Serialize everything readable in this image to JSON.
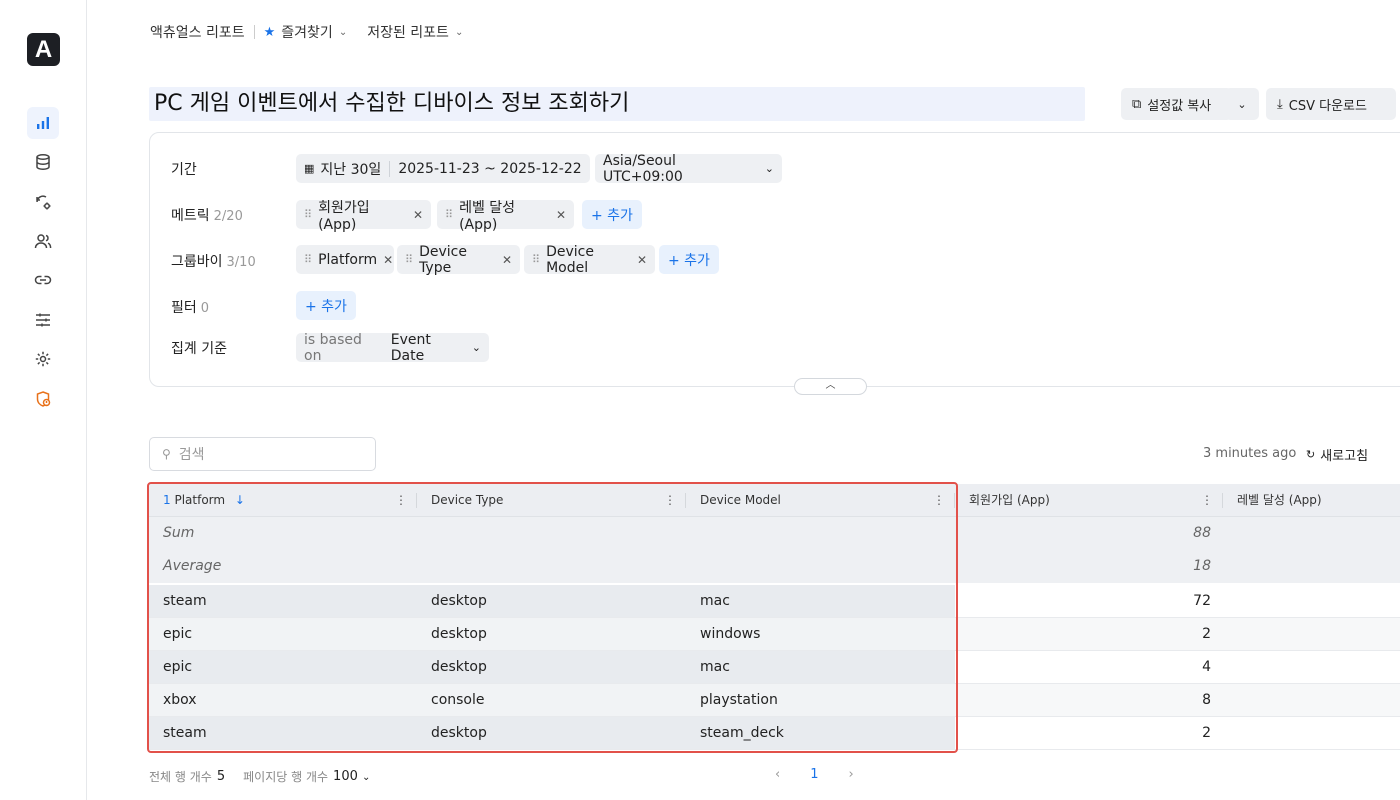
{
  "app": {
    "logo_letter": "A"
  },
  "sidebar": {
    "items": [
      {
        "name": "chart-icon"
      },
      {
        "name": "database-icon"
      },
      {
        "name": "sync-settings-icon"
      },
      {
        "name": "users-icon"
      },
      {
        "name": "link-icon"
      },
      {
        "name": "sliders-icon"
      },
      {
        "name": "gear-icon"
      },
      {
        "name": "security-alert-icon"
      }
    ],
    "accent": "#1a73e8",
    "alert_color": "#e8711a"
  },
  "breadcrumb": {
    "root": "액츄얼스 리포트",
    "favorites": "즐겨찾기",
    "saved": "저장된 리포트"
  },
  "report": {
    "title": "PC 게임 이벤트에서 수집한 디바이스 정보 조회하기",
    "copy_settings": "설정값 복사",
    "csv_download": "CSV 다운로드"
  },
  "filters": {
    "period_label": "기간",
    "period_preset": "지난 30일",
    "period_range": "2025-11-23 ~ 2025-12-22",
    "timezone": "Asia/Seoul UTC+09:00",
    "metrics_label": "메트릭",
    "metrics_count": "2/20",
    "metrics": [
      "회원가입 (App)",
      "레벨 달성 (App)"
    ],
    "groupby_label": "그룹바이",
    "groupby_count": "3/10",
    "groupby": [
      "Platform",
      "Device Type",
      "Device Model"
    ],
    "filter_label": "필터",
    "filter_count": "0",
    "add_label": "+ 추가",
    "agg_label": "집계 기준",
    "agg_prefix": "is based on",
    "agg_value": "Event Date"
  },
  "toolbar": {
    "search_placeholder": "검색",
    "updated": "3 minutes ago",
    "refresh": "새로고침"
  },
  "table": {
    "sort_index": "1",
    "columns": [
      "Platform",
      "Device Type",
      "Device Model",
      "회원가입 (App)",
      "레벨 달성 (App)"
    ],
    "sum_label": "Sum",
    "avg_label": "Average",
    "sum_value": "88",
    "avg_value": "18",
    "rows": [
      [
        "steam",
        "desktop",
        "mac",
        "72"
      ],
      [
        "epic",
        "desktop",
        "windows",
        "2"
      ],
      [
        "epic",
        "desktop",
        "mac",
        "4"
      ],
      [
        "xbox",
        "console",
        "playstation",
        "8"
      ],
      [
        "steam",
        "desktop",
        "steam_deck",
        "2"
      ]
    ]
  },
  "footer": {
    "total_label": "전체 행 개수",
    "total_value": "5",
    "per_page_label": "페이지당 행 개수",
    "per_page_value": "100",
    "current_page": "1"
  }
}
